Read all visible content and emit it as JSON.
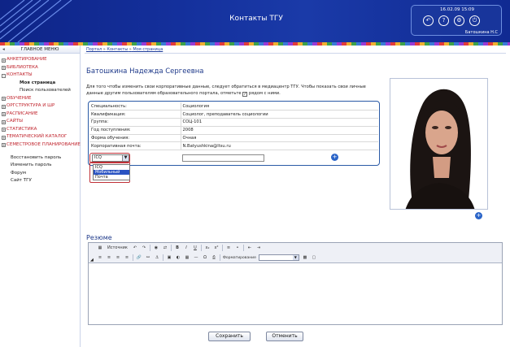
{
  "header": {
    "title": "Контакты ТГУ",
    "datetime": "16.02.09 15:09",
    "user": "Батошкина Н.С",
    "icons": [
      "back-icon",
      "help-icon",
      "settings-icon",
      "power-icon"
    ]
  },
  "sidebar": {
    "title": "ГЛАВНОЕ МЕНЮ",
    "items": [
      {
        "label": "АНКЕТИРОВАНИЕ",
        "kind": "top",
        "toggle": "+"
      },
      {
        "label": "БИБЛИОТЕКА",
        "kind": "top",
        "toggle": "+"
      },
      {
        "label": "КОНТАКТЫ",
        "kind": "top",
        "toggle": "-"
      },
      {
        "label": "Моя страница",
        "kind": "sub-active"
      },
      {
        "label": "Поиск пользователей",
        "kind": "sub"
      },
      {
        "label": "ОБУЧЕНИЕ",
        "kind": "top",
        "toggle": "+"
      },
      {
        "label": "ОРГСТРУКТУРА И ШР",
        "kind": "top",
        "toggle": "+"
      },
      {
        "label": "РАСПИСАНИЕ",
        "kind": "top",
        "toggle": "+"
      },
      {
        "label": "САЙТЫ",
        "kind": "top",
        "toggle": "+"
      },
      {
        "label": "СТАТИСТИКА",
        "kind": "top",
        "toggle": "+"
      },
      {
        "label": "ТЕМАТИЧЕСКИЙ КАТАЛОГ",
        "kind": "top",
        "toggle": "+"
      },
      {
        "label": "СЕМЕСТРОВОЕ ПЛАНИРОВАНИЕ",
        "kind": "top-two",
        "toggle": "+"
      },
      {
        "label": "Восстановить пароль",
        "kind": "plain"
      },
      {
        "label": "Изменить пароль",
        "kind": "plain"
      },
      {
        "label": "Форум",
        "kind": "plain"
      },
      {
        "label": "Сайт ТГУ",
        "kind": "plain"
      }
    ]
  },
  "breadcrumb": {
    "items": [
      "Портал",
      "Контакты",
      "Моя страница"
    ],
    "separator": "»"
  },
  "profile": {
    "name": "Батошкина Надежда Сергеевна",
    "note_before": "Для того чтобы изменить свои корпоративные данные, следует обратиться в медиацентр ТГУ. Чтобы показать свои личные данные другим пользователям образовательного портала, отметьте",
    "note_after": "рядом с ними.",
    "fields": [
      {
        "label": "Специальность:",
        "value": "Социология"
      },
      {
        "label": "Квалификация:",
        "value": "Социолог, преподаватель социологии"
      },
      {
        "label": "Группа:",
        "value": "СОЦ-101"
      },
      {
        "label": "Год поступления:",
        "value": "2008"
      },
      {
        "label": "Форма обучения:",
        "value": "Очная"
      },
      {
        "label": "Корпоративная почта:",
        "value": "N.Batyushkina@ltsu.ru"
      }
    ]
  },
  "contact": {
    "type_selected": "ICQ",
    "type_options": [
      "ICQ",
      "Мобильный",
      "Почта"
    ],
    "highlighted_option": "Мобильный",
    "value": "",
    "add_icon": "plus-circle-icon"
  },
  "photo": {
    "add_icon": "plus-circle-icon"
  },
  "resume": {
    "title": "Резюме",
    "source_label": "Источник",
    "format_label": "Форматирование",
    "format_value": ""
  },
  "buttons": {
    "save": "Сохранить",
    "cancel": "Отменить"
  }
}
